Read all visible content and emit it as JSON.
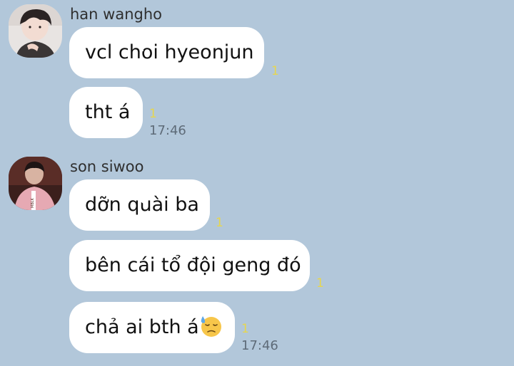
{
  "chat": {
    "groups": [
      {
        "sender": "han wangho",
        "avatar_icon": "user-avatar-photo",
        "messages": [
          {
            "text": "vcl choi hyeonjun",
            "unread": "1",
            "time": ""
          },
          {
            "text": "tht á",
            "unread": "1",
            "time": "17:46"
          }
        ]
      },
      {
        "sender": "son siwoo",
        "avatar_icon": "user-avatar-photo",
        "messages": [
          {
            "text": "dỡn quài ba",
            "unread": "1",
            "time": ""
          },
          {
            "text": "bên cái tổ đội geng đó",
            "unread": "1",
            "time": ""
          },
          {
            "text": "chả ai bth á",
            "emoji": "downcast-face-with-sweat-icon",
            "unread": "1",
            "time": "17:46"
          }
        ]
      }
    ]
  },
  "colors": {
    "background": "#b2c7da",
    "bubble": "#ffffff",
    "unread": "#e7d64f",
    "time": "#5e6b78"
  }
}
